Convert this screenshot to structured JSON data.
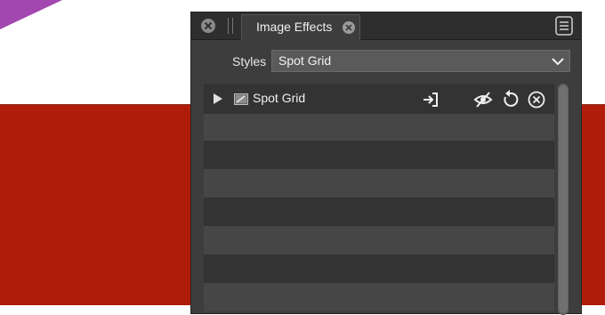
{
  "panel": {
    "tab_title": "Image Effects",
    "styles_label": "Styles",
    "styles_value": "Spot Grid"
  },
  "effects": [
    {
      "name": "Spot Grid",
      "icons": [
        "expand-triangle-icon",
        "effect-thumbnail-icon",
        "apply-icon",
        "visibility-off-icon",
        "reset-icon",
        "remove-icon"
      ]
    }
  ],
  "colors": {
    "canvas_white": "#ffffff",
    "canvas_red": "#b01c0a",
    "shape_purple": "#a347b0",
    "panel_bg": "#3d3d3d",
    "tab_bar_bg": "#2e2e2e",
    "select_bg": "#5a5a5a",
    "row_dark": "#333333",
    "row_light": "#464646",
    "icon_color": "#f0f0f0"
  }
}
